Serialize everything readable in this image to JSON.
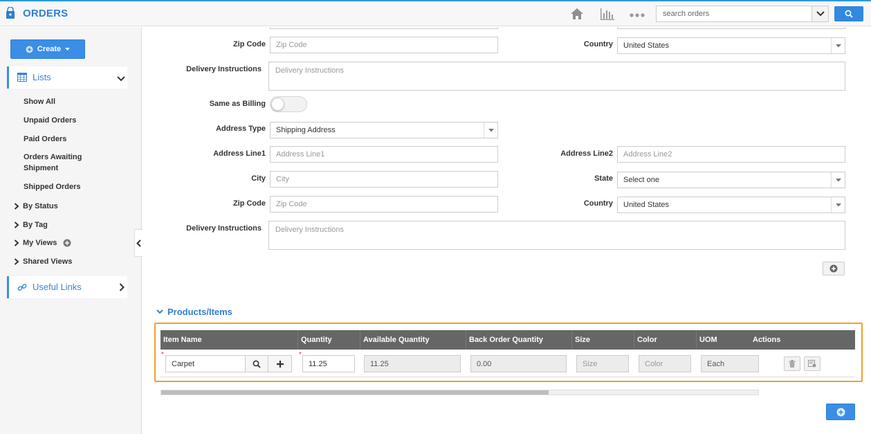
{
  "app": {
    "title": "ORDERS"
  },
  "search": {
    "placeholder": "search orders"
  },
  "colors": {
    "accent": "#3a8ee6",
    "highlight": "#f0a02a",
    "table_header": "#666666"
  },
  "sidebar": {
    "create_label": "Create",
    "lists_label": "Lists",
    "items": [
      "Show All",
      "Unpaid Orders",
      "Paid Orders",
      "Orders Awaiting Shipment",
      "Shipped Orders"
    ],
    "groups": [
      "By Status",
      "By Tag",
      "My Views",
      "Shared Views"
    ],
    "useful_links_label": "Useful Links"
  },
  "billing": {
    "zip_label": "Zip Code",
    "zip_placeholder": "Zip Code",
    "country_label": "Country",
    "country_value": "United States",
    "delivery_label": "Delivery Instructions",
    "delivery_placeholder": "Delivery Instructions"
  },
  "shipping": {
    "same_as_billing_label": "Same as Billing",
    "address_type_label": "Address Type",
    "address_type_value": "Shipping Address",
    "line1_label": "Address Line1",
    "line1_placeholder": "Address Line1",
    "line2_label": "Address Line2",
    "line2_placeholder": "Address Line2",
    "city_label": "City",
    "city_placeholder": "City",
    "state_label": "State",
    "state_value": "Select one",
    "zip_label": "Zip Code",
    "zip_placeholder": "Zip Code",
    "country_label": "Country",
    "country_value": "United States",
    "delivery_label": "Delivery Instructions",
    "delivery_placeholder": "Delivery Instructions"
  },
  "products": {
    "title": "Products/Items",
    "columns": [
      "Item Name",
      "Quantity",
      "Available Quantity",
      "Back Order Quantity",
      "Size",
      "Color",
      "UOM",
      "Actions"
    ],
    "row": {
      "item_name": "Carpet",
      "quantity": "11.25",
      "available_quantity": "11.25",
      "back_order_quantity": "0.00",
      "size_placeholder": "Size",
      "color_placeholder": "Color",
      "uom": "Each"
    },
    "required_mark": "*"
  }
}
